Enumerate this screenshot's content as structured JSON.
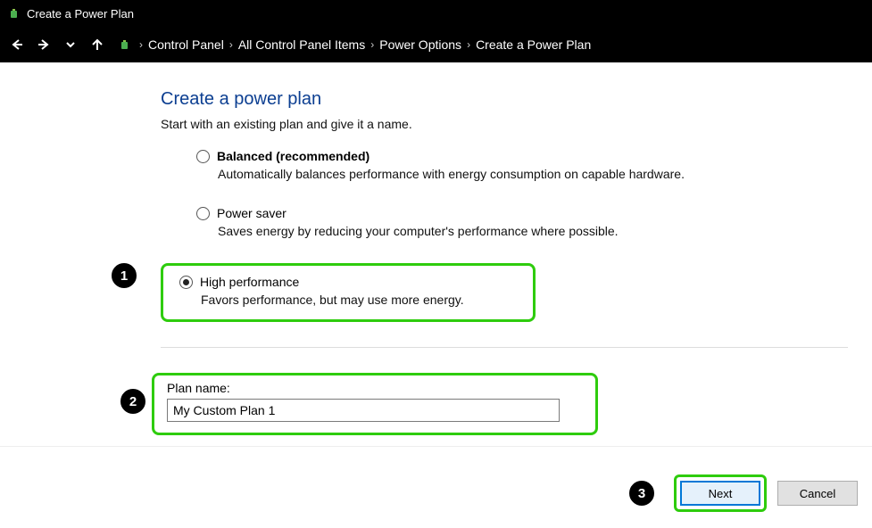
{
  "window": {
    "title": "Create a Power Plan"
  },
  "breadcrumbs": [
    "Control Panel",
    "All Control Panel Items",
    "Power Options",
    "Create a Power Plan"
  ],
  "heading": "Create a power plan",
  "subtitle": "Start with an existing plan and give it a name.",
  "options": {
    "balanced": {
      "label": "Balanced (recommended)",
      "desc": "Automatically balances performance with energy consumption on capable hardware."
    },
    "saver": {
      "label": "Power saver",
      "desc": "Saves energy by reducing your computer's performance where possible."
    },
    "high": {
      "label": "High performance",
      "desc": "Favors performance, but may use more energy."
    }
  },
  "planName": {
    "label": "Plan name:",
    "value": "My Custom Plan 1"
  },
  "buttons": {
    "next": "Next",
    "cancel": "Cancel"
  },
  "markers": {
    "m1": "1",
    "m2": "2",
    "m3": "3"
  }
}
